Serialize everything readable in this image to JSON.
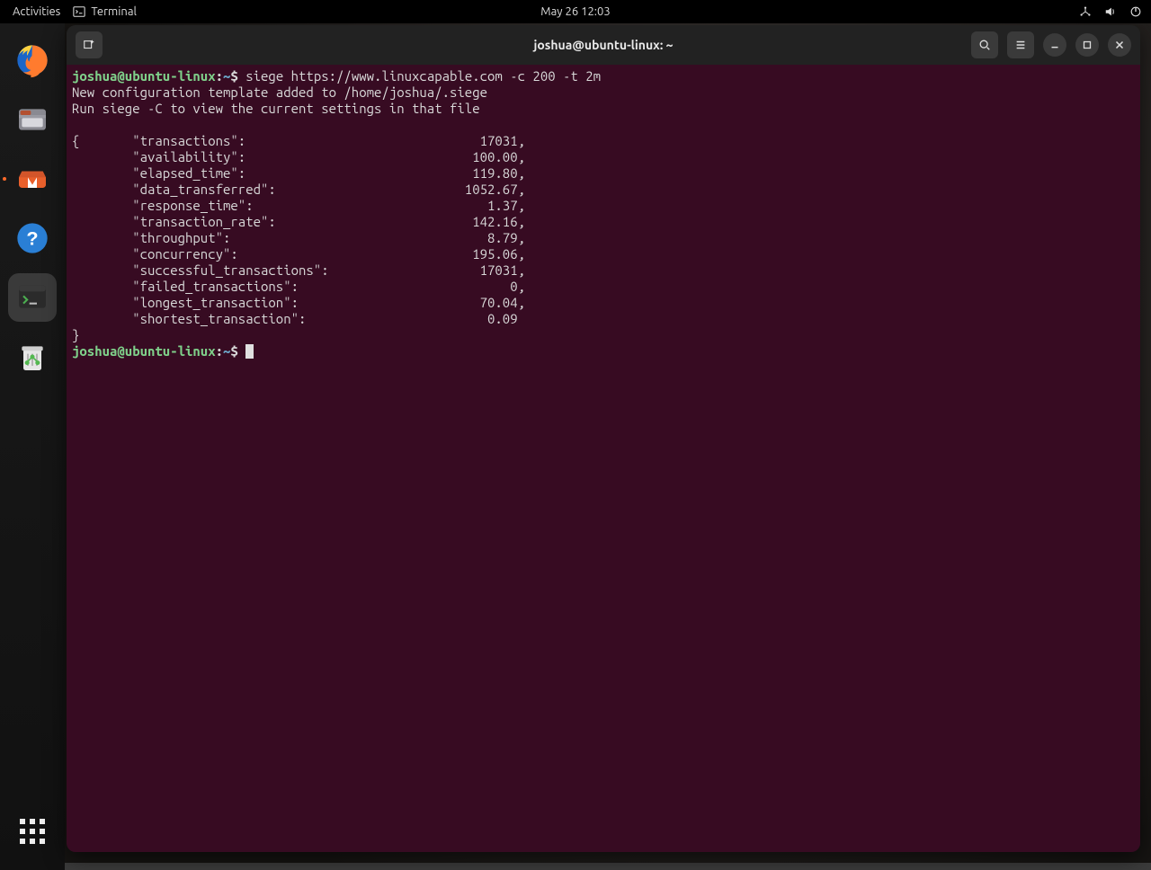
{
  "topbar": {
    "activities": "Activities",
    "app_label": "Terminal",
    "datetime": "May 26  12:03"
  },
  "window": {
    "title": "joshua@ubuntu-linux: ~"
  },
  "prompt": {
    "user": "joshua",
    "host": "ubuntu-linux",
    "path": "~",
    "symbol": "$"
  },
  "command": "siege https://www.linuxcapable.com -c 200 -t 2m",
  "messages": [
    "New configuration template added to /home/joshua/.siege",
    "Run siege -C to view the current settings in that file"
  ],
  "result_open": "{",
  "result_close": "}",
  "results": [
    {
      "key": "transactions",
      "value": "17031",
      "comma": true
    },
    {
      "key": "availability",
      "value": "100.00",
      "comma": true
    },
    {
      "key": "elapsed_time",
      "value": "119.80",
      "comma": true
    },
    {
      "key": "data_transferred",
      "value": "1052.67",
      "comma": true
    },
    {
      "key": "response_time",
      "value": "1.37",
      "comma": true
    },
    {
      "key": "transaction_rate",
      "value": "142.16",
      "comma": true
    },
    {
      "key": "throughput",
      "value": "8.79",
      "comma": true
    },
    {
      "key": "concurrency",
      "value": "195.06",
      "comma": true
    },
    {
      "key": "successful_transactions",
      "value": "17031",
      "comma": true
    },
    {
      "key": "failed_transactions",
      "value": "0",
      "comma": true
    },
    {
      "key": "longest_transaction",
      "value": "70.04",
      "comma": true
    },
    {
      "key": "shortest_transaction",
      "value": "0.09",
      "comma": false
    }
  ]
}
